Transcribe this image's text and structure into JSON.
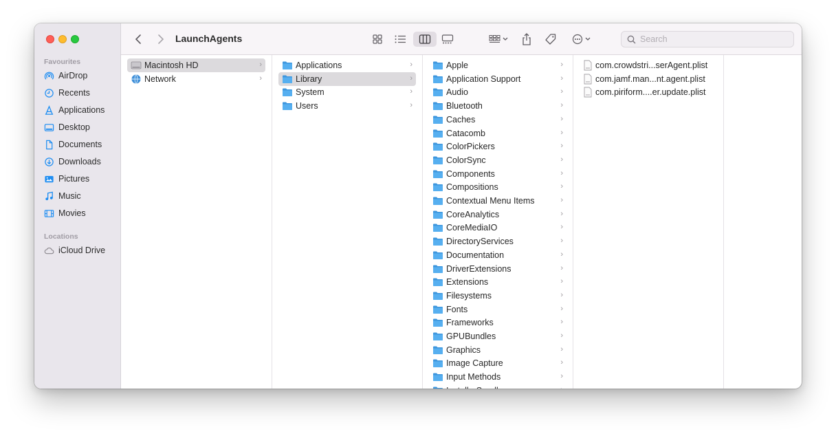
{
  "window": {
    "title": "LaunchAgents",
    "colors": {
      "accent": "#1d8df2",
      "folder": "#56aff0",
      "sidebar_bg": "#e9e6ec"
    }
  },
  "sidebar": {
    "favourites_title": "Favourites",
    "favourites": [
      {
        "label": "AirDrop",
        "icon": "airdrop-icon"
      },
      {
        "label": "Recents",
        "icon": "clock-icon"
      },
      {
        "label": "Applications",
        "icon": "applications-icon"
      },
      {
        "label": "Desktop",
        "icon": "desktop-icon"
      },
      {
        "label": "Documents",
        "icon": "document-icon"
      },
      {
        "label": "Downloads",
        "icon": "download-icon"
      },
      {
        "label": "Pictures",
        "icon": "pictures-icon"
      },
      {
        "label": "Music",
        "icon": "music-icon"
      },
      {
        "label": "Movies",
        "icon": "movies-icon"
      }
    ],
    "locations_title": "Locations",
    "locations": [
      {
        "label": "iCloud Drive",
        "icon": "cloud-icon"
      }
    ]
  },
  "toolbar": {
    "back": "back-icon",
    "forward": "forward-icon",
    "views": [
      "icon-view-icon",
      "list-view-icon",
      "column-view-icon",
      "gallery-view-icon"
    ],
    "active_view": "column-view-icon",
    "search_placeholder": "Search"
  },
  "columns": [
    {
      "items": [
        {
          "label": "Macintosh HD",
          "icon": "hard-drive-icon",
          "selected": true
        },
        {
          "label": "Network",
          "icon": "network-icon",
          "selected": false
        }
      ]
    },
    {
      "items": [
        {
          "label": "Applications",
          "icon": "folder-icon",
          "selected": false
        },
        {
          "label": "Library",
          "icon": "folder-icon",
          "selected": true
        },
        {
          "label": "System",
          "icon": "folder-icon",
          "selected": false
        },
        {
          "label": "Users",
          "icon": "folder-icon",
          "selected": false
        }
      ]
    },
    {
      "items": [
        {
          "label": "Apple",
          "icon": "folder-icon"
        },
        {
          "label": "Application Support",
          "icon": "folder-icon"
        },
        {
          "label": "Audio",
          "icon": "folder-icon"
        },
        {
          "label": "Bluetooth",
          "icon": "folder-icon"
        },
        {
          "label": "Caches",
          "icon": "folder-icon"
        },
        {
          "label": "Catacomb",
          "icon": "folder-icon"
        },
        {
          "label": "ColorPickers",
          "icon": "folder-icon"
        },
        {
          "label": "ColorSync",
          "icon": "folder-icon"
        },
        {
          "label": "Components",
          "icon": "folder-icon"
        },
        {
          "label": "Compositions",
          "icon": "folder-icon"
        },
        {
          "label": "Contextual Menu Items",
          "icon": "folder-icon"
        },
        {
          "label": "CoreAnalytics",
          "icon": "folder-icon"
        },
        {
          "label": "CoreMediaIO",
          "icon": "folder-icon"
        },
        {
          "label": "DirectoryServices",
          "icon": "folder-icon"
        },
        {
          "label": "Documentation",
          "icon": "folder-icon"
        },
        {
          "label": "DriverExtensions",
          "icon": "folder-icon"
        },
        {
          "label": "Extensions",
          "icon": "folder-icon"
        },
        {
          "label": "Filesystems",
          "icon": "folder-icon"
        },
        {
          "label": "Fonts",
          "icon": "folder-icon"
        },
        {
          "label": "Frameworks",
          "icon": "folder-icon"
        },
        {
          "label": "GPUBundles",
          "icon": "folder-icon"
        },
        {
          "label": "Graphics",
          "icon": "folder-icon"
        },
        {
          "label": "Image Capture",
          "icon": "folder-icon"
        },
        {
          "label": "Input Methods",
          "icon": "folder-icon"
        },
        {
          "label": "InstallerSandboxes",
          "icon": "folder-icon"
        }
      ]
    },
    {
      "items": [
        {
          "label": "com.crowdstri...serAgent.plist",
          "icon": "plist-file-icon"
        },
        {
          "label": "com.jamf.man...nt.agent.plist",
          "icon": "plist-file-icon"
        },
        {
          "label": "com.piriform....er.update.plist",
          "icon": "plist-file-icon"
        }
      ]
    }
  ]
}
